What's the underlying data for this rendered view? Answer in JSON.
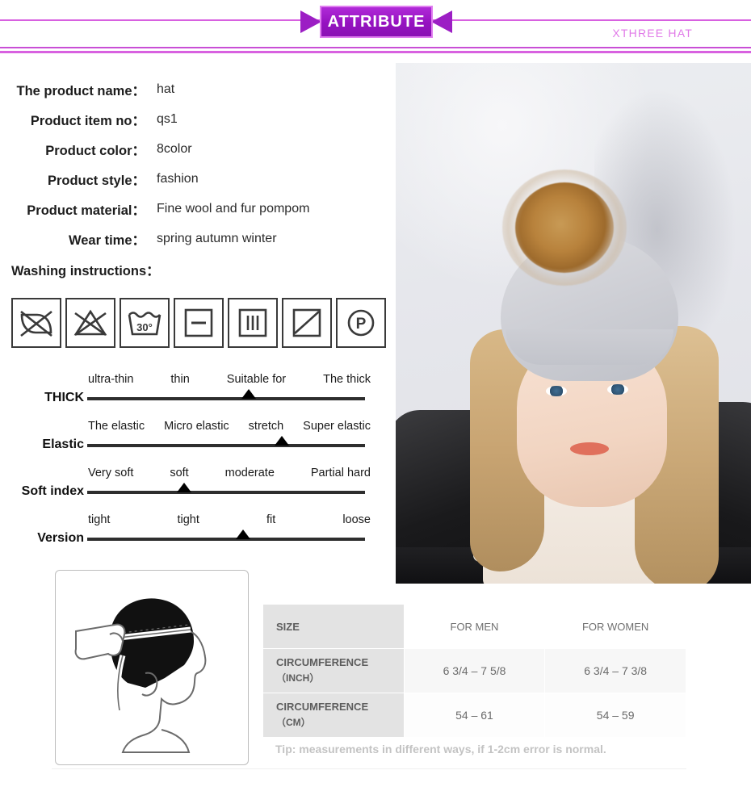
{
  "header": {
    "ribbon_title": "ATTRIBUTE",
    "brand": "XTHREE HAT",
    "rule_color": "#d861e0",
    "ribbon_color": "#9512c0"
  },
  "specs": {
    "rows": [
      {
        "label": "The product name：",
        "value": "hat"
      },
      {
        "label": "Product item no：",
        "value": "qs1"
      },
      {
        "label": "Product color：",
        "value": "8color"
      },
      {
        "label": "Product style：",
        "value": "fashion"
      },
      {
        "label": "Product material：",
        "value": "Fine wool and fur pompom"
      },
      {
        "label": "Wear time：",
        "value": "spring autumn winter"
      }
    ],
    "washing_title": "Washing instructions："
  },
  "care_symbols": [
    {
      "name": "do-not-wring-icon",
      "label": "Do not wring"
    },
    {
      "name": "do-not-bleach-icon",
      "label": "Do not bleach"
    },
    {
      "name": "wash-30-degrees-icon",
      "label": "Machine wash 30°",
      "text": "30°"
    },
    {
      "name": "dry-flat-icon",
      "label": "Dry flat"
    },
    {
      "name": "drip-dry-icon",
      "label": "Drip dry"
    },
    {
      "name": "dry-in-shade-icon",
      "label": "Dry in shade"
    },
    {
      "name": "dry-clean-p-icon",
      "label": "Dry clean with petroleum solvent",
      "text": "P"
    }
  ],
  "scales": [
    {
      "name": "THICK",
      "options": [
        "ultra-thin",
        "thin",
        "Suitable for",
        "The thick"
      ],
      "marker_percent": 58,
      "selected": "Suitable for"
    },
    {
      "name": "Elastic",
      "options": [
        "The elastic",
        "Micro elastic",
        "stretch",
        "Super elastic"
      ],
      "marker_percent": 70,
      "selected": "stretch"
    },
    {
      "name": "Soft index",
      "options": [
        "Very soft",
        "soft",
        "moderate",
        "Partial hard"
      ],
      "marker_percent": 35,
      "selected": "soft"
    },
    {
      "name": "Version",
      "options": [
        "tight",
        "tight",
        "fit",
        "loose"
      ],
      "marker_percent": 56,
      "selected": "fit"
    }
  ],
  "photo": {
    "alt": "Woman wearing grey knitted beanie with fur pompom"
  },
  "head_diagram": {
    "alt": "Head profile with measuring tape around circumference"
  },
  "size_table": {
    "headers": [
      "SIZE",
      "FOR MEN",
      "FOR WOMEN"
    ],
    "rows": [
      {
        "label_main": "CIRCUMFERENCE",
        "label_unit": "（INCH）",
        "men": "6 3/4 – 7 5/8",
        "women": "6 3/4 – 7 3/8"
      },
      {
        "label_main": "CIRCUMFERENCE",
        "label_unit": "（CM）",
        "men": "54 – 61",
        "women": "54 – 59"
      }
    ],
    "tip": "Tip: measurements in different ways, if 1-2cm error is normal."
  }
}
